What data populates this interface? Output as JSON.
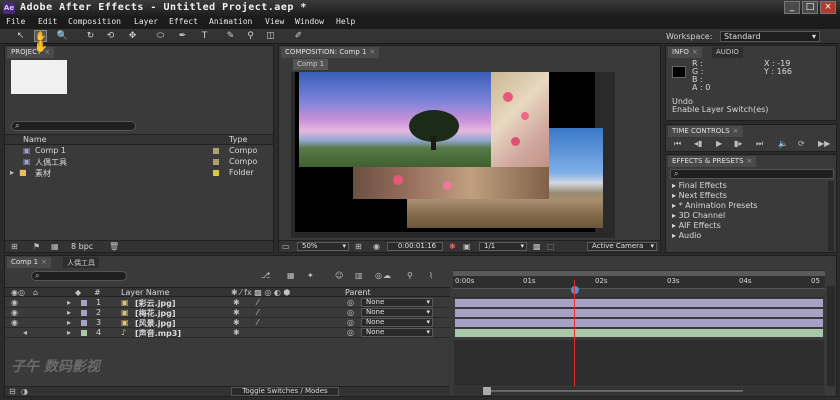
{
  "app": {
    "title": "Adobe After Effects - Untitled Project.aep *",
    "logo_text": "Ae"
  },
  "window_controls": {
    "minimize": "_",
    "maximize": "□",
    "close": "×"
  },
  "menu": [
    "File",
    "Edit",
    "Composition",
    "Layer",
    "Effect",
    "Animation",
    "View",
    "Window",
    "Help"
  ],
  "toolbar": {
    "tools": [
      "selection-tool",
      "hand-tool",
      "zoom-tool",
      "rotation-tool",
      "camera-orbit-tool",
      "pan-behind-tool",
      "ellipse-tool",
      "pen-tool",
      "type-tool",
      "brush-tool",
      "clone-stamp-tool",
      "eraser-tool",
      "roto-brush-tool"
    ],
    "tool_glyphs": [
      "↖",
      "✋",
      "🔍",
      "↻",
      "⟲",
      "✥",
      "⬭",
      "✒",
      "T",
      "✎",
      "⚲",
      "◫",
      "✐"
    ],
    "workspace_label": "Workspace:",
    "workspace_value": "Standard"
  },
  "project_panel": {
    "tab": "PROJECT",
    "columns": {
      "name": "Name",
      "type": "Type"
    },
    "items": [
      {
        "name": "Comp 1",
        "type": "Compo",
        "color": "#b0a070",
        "kind": "comp"
      },
      {
        "name": "人偶工具",
        "type": "Compo",
        "color": "#b0a070",
        "kind": "comp"
      },
      {
        "name": "素材",
        "type": "Folder",
        "color": "#d8c840",
        "kind": "folder"
      }
    ],
    "bpc": "8 bpc"
  },
  "composition_panel": {
    "tab": "COMPOSITION: Comp 1",
    "subtab": "Comp 1",
    "zoom": "50%",
    "timecode": "0:00:01:16",
    "resolution": "1/1",
    "camera": "Active Camera"
  },
  "info_panel": {
    "tabs": [
      "INFO",
      "AUDIO"
    ],
    "r_label": "R :",
    "g_label": "G :",
    "b_label": "B :",
    "a_label": "A :  0",
    "x_label": "X : -19",
    "y_label": "Y : 166",
    "undo_label": "Undo",
    "undo_action": "Enable Layer Switch(es)"
  },
  "time_controls": {
    "tab": "TIME CONTROLS"
  },
  "effects_panel": {
    "tab": "EFFECTS & PRESETS",
    "items": [
      "Final Effects",
      "Next Effects",
      "* Animation Presets",
      "3D Channel",
      "AIF Effects",
      "Audio"
    ]
  },
  "timeline": {
    "tabs": [
      "Comp 1",
      "人偶工具"
    ],
    "columns": {
      "num": "#",
      "layer_name": "Layer Name",
      "parent": "Parent"
    },
    "layers": [
      {
        "num": "1",
        "name": "[彩云.jpg]",
        "parent": "None",
        "kind": "image"
      },
      {
        "num": "2",
        "name": "[梅花.jpg]",
        "parent": "None",
        "kind": "image"
      },
      {
        "num": "3",
        "name": "[风景.jpg]",
        "parent": "None",
        "kind": "image"
      },
      {
        "num": "4",
        "name": "[声音.mp3]",
        "parent": "None",
        "kind": "audio"
      }
    ],
    "ruler": [
      "0:00s",
      "01s",
      "02s",
      "03s",
      "04s",
      "05"
    ],
    "footer_button": "Toggle Switches / Modes",
    "watermark": "子午 数码影视"
  }
}
